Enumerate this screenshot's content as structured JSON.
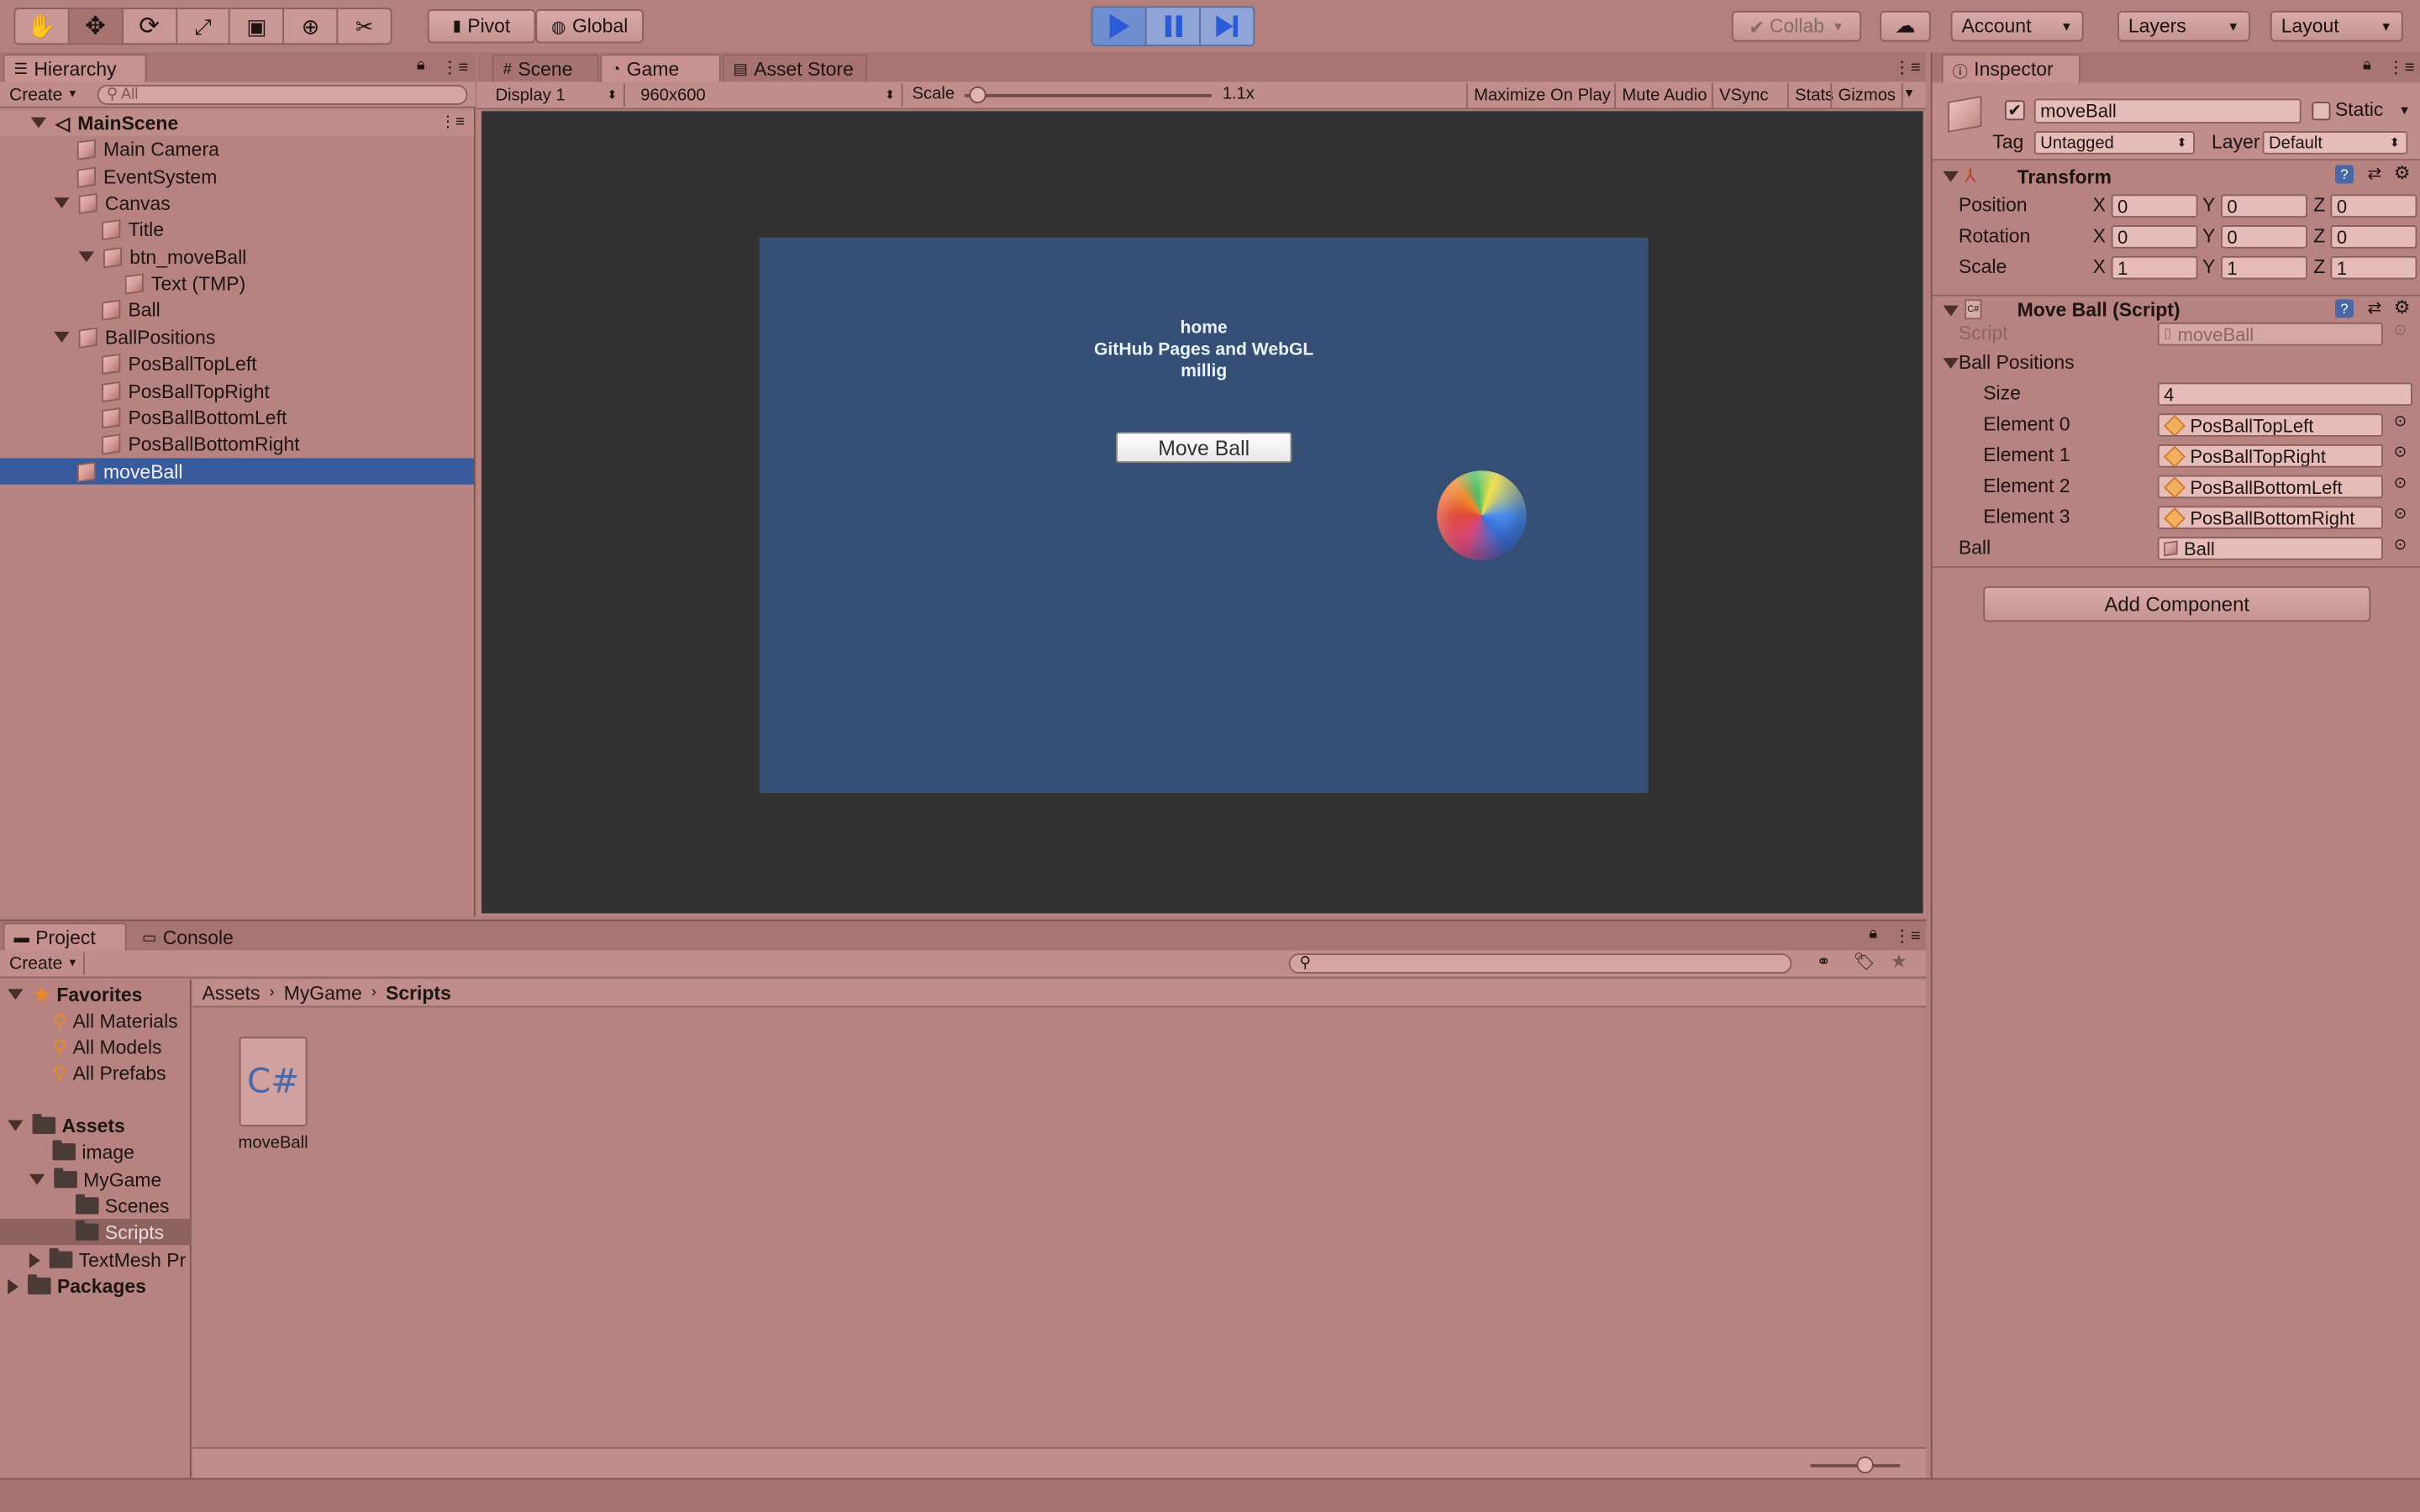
{
  "toolbar": {
    "pivot": "Pivot",
    "global": "Global",
    "collab": "Collab",
    "account": "Account",
    "layers": "Layers",
    "layout": "Layout"
  },
  "hierarchy": {
    "tab": "Hierarchy",
    "create": "Create",
    "search_placeholder": "All",
    "scene": "MainScene",
    "items": [
      {
        "label": "Main Camera"
      },
      {
        "label": "EventSystem"
      },
      {
        "label": "Canvas"
      },
      {
        "label": "Title"
      },
      {
        "label": "btn_moveBall"
      },
      {
        "label": "Text (TMP)"
      },
      {
        "label": "Ball"
      },
      {
        "label": "BallPositions"
      },
      {
        "label": "PosBallTopLeft"
      },
      {
        "label": "PosBallTopRight"
      },
      {
        "label": "PosBallBottomLeft"
      },
      {
        "label": "PosBallBottomRight"
      },
      {
        "label": "moveBall"
      }
    ]
  },
  "view_tabs": {
    "scene": "Scene",
    "game": "Game",
    "asset_store": "Asset Store"
  },
  "game_toolbar": {
    "display": "Display 1",
    "resolution": "960x600",
    "scale_label": "Scale",
    "scale_value": "1.1x",
    "scale_fraction": 0.02,
    "maximize": "Maximize On Play",
    "mute": "Mute Audio",
    "vsync": "VSync",
    "stats": "Stats",
    "gizmos": "Gizmos"
  },
  "game_view": {
    "title_lines": [
      "home",
      "GitHub Pages and WebGL",
      "millig"
    ],
    "button": "Move Ball"
  },
  "inspector": {
    "tab": "Inspector",
    "object_name": "moveBall",
    "static": "Static",
    "tag_label": "Tag",
    "tag_value": "Untagged",
    "layer_label": "Layer",
    "layer_value": "Default",
    "transform": {
      "title": "Transform",
      "position_label": "Position",
      "rotation_label": "Rotation",
      "scale_label": "Scale",
      "position": [
        "0",
        "0",
        "0"
      ],
      "rotation": [
        "0",
        "0",
        "0"
      ],
      "scale": [
        "1",
        "1",
        "1"
      ],
      "x": "X",
      "y": "Y",
      "z": "Z"
    },
    "script": {
      "title": "Move Ball (Script)",
      "script_label": "Script",
      "script_value": "moveBall",
      "ball_positions": "Ball Positions",
      "size_label": "Size",
      "size_value": "4",
      "elements": [
        {
          "label": "Element 0",
          "value": "PosBallTopLeft"
        },
        {
          "label": "Element 1",
          "value": "PosBallTopRight"
        },
        {
          "label": "Element 2",
          "value": "PosBallBottomLeft"
        },
        {
          "label": "Element 3",
          "value": "PosBallBottomRight"
        }
      ],
      "ball_label": "Ball",
      "ball_value": "Ball"
    },
    "add_component": "Add Component"
  },
  "project": {
    "tab": "Project",
    "console_tab": "Console",
    "create": "Create",
    "favorites": "Favorites",
    "fav_items": [
      "All Materials",
      "All Models",
      "All Prefabs"
    ],
    "assets": "Assets",
    "folders": [
      {
        "label": "image"
      },
      {
        "label": "MyGame"
      },
      {
        "label": "Scenes"
      },
      {
        "label": "Scripts"
      },
      {
        "label": "TextMesh Pr"
      }
    ],
    "packages": "Packages",
    "breadcrumb": [
      "Assets",
      "MyGame",
      "Scripts"
    ],
    "file": "moveBall",
    "file_glyph": "C#"
  }
}
